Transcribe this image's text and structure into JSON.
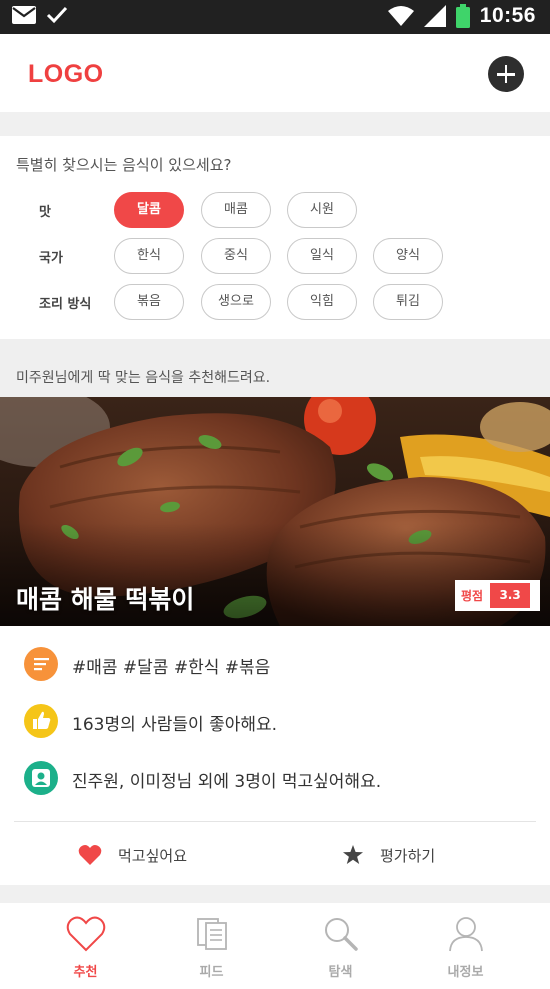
{
  "status_bar": {
    "time": "10:56"
  },
  "header": {
    "logo": "LOGO"
  },
  "filters": {
    "question": "특별히 찾으시는 음식이 있으세요?",
    "rows": [
      {
        "label": "맛",
        "options": [
          "달콤",
          "매콤",
          "시원"
        ]
      },
      {
        "label": "국가",
        "options": [
          "한식",
          "중식",
          "일식",
          "양식"
        ]
      },
      {
        "label": "조리 방식",
        "options": [
          "볶음",
          "생으로",
          "익힘",
          "튀김"
        ]
      }
    ],
    "selected": "달콤"
  },
  "recommendation": {
    "title": "미주원님에게 딱 맞는 음식을 추천해드려요.",
    "food_name": "매콤 해물 떡볶이",
    "rating_label": "평점",
    "rating_value": "3.3",
    "tags": "#매콤 #달콤 #한식 #볶음",
    "likes": "163명의 사람들이 좋아해요.",
    "wants": "진주원, 이미정님 외에 3명이 먹고싶어해요.",
    "want_button": "먹고싶어요",
    "rate_button": "평가하기"
  },
  "tabs": [
    {
      "label": "추천",
      "icon": "heart-outline-icon",
      "active": true
    },
    {
      "label": "피드",
      "icon": "documents-icon",
      "active": false
    },
    {
      "label": "탐색",
      "icon": "search-icon",
      "active": false
    },
    {
      "label": "내정보",
      "icon": "person-icon",
      "active": false
    }
  ],
  "colors": {
    "accent": "#f04848",
    "icon_orange": "#f7923a",
    "icon_yellow": "#f5c518",
    "icon_green": "#1cb08a"
  }
}
